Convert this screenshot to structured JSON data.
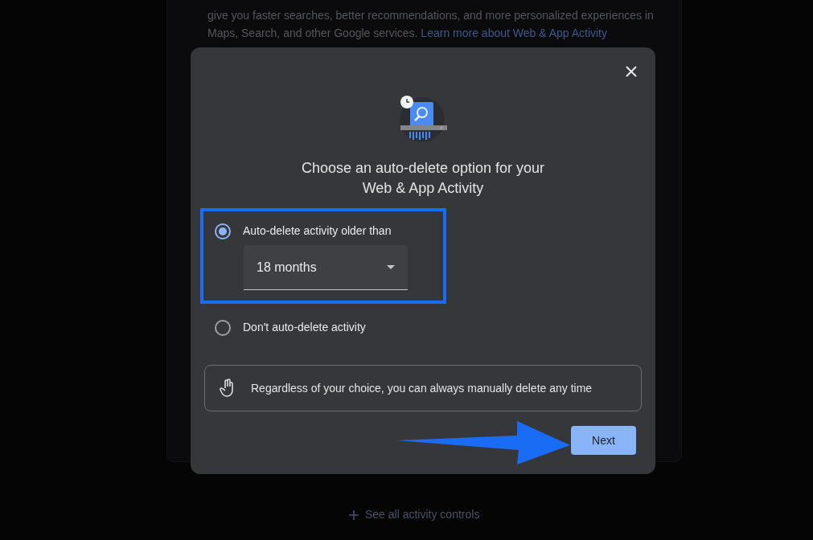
{
  "background": {
    "description": "give you faster searches, better recommendations, and more personalized experiences in Maps, Search, and other Google services.",
    "link": "Learn more about Web & App Activity",
    "see_all": "See all activity controls"
  },
  "dialog": {
    "title": "Choose an auto-delete option for your Web & App Activity",
    "options": [
      {
        "label": "Auto-delete activity older than",
        "selected": true,
        "dropdown": {
          "value": "18 months"
        }
      },
      {
        "label": "Don't auto-delete activity",
        "selected": false
      }
    ],
    "info": "Regardless of your choice, you can always manually delete any time",
    "buttons": [
      {
        "label": "Next",
        "kind": "primary"
      }
    ]
  }
}
